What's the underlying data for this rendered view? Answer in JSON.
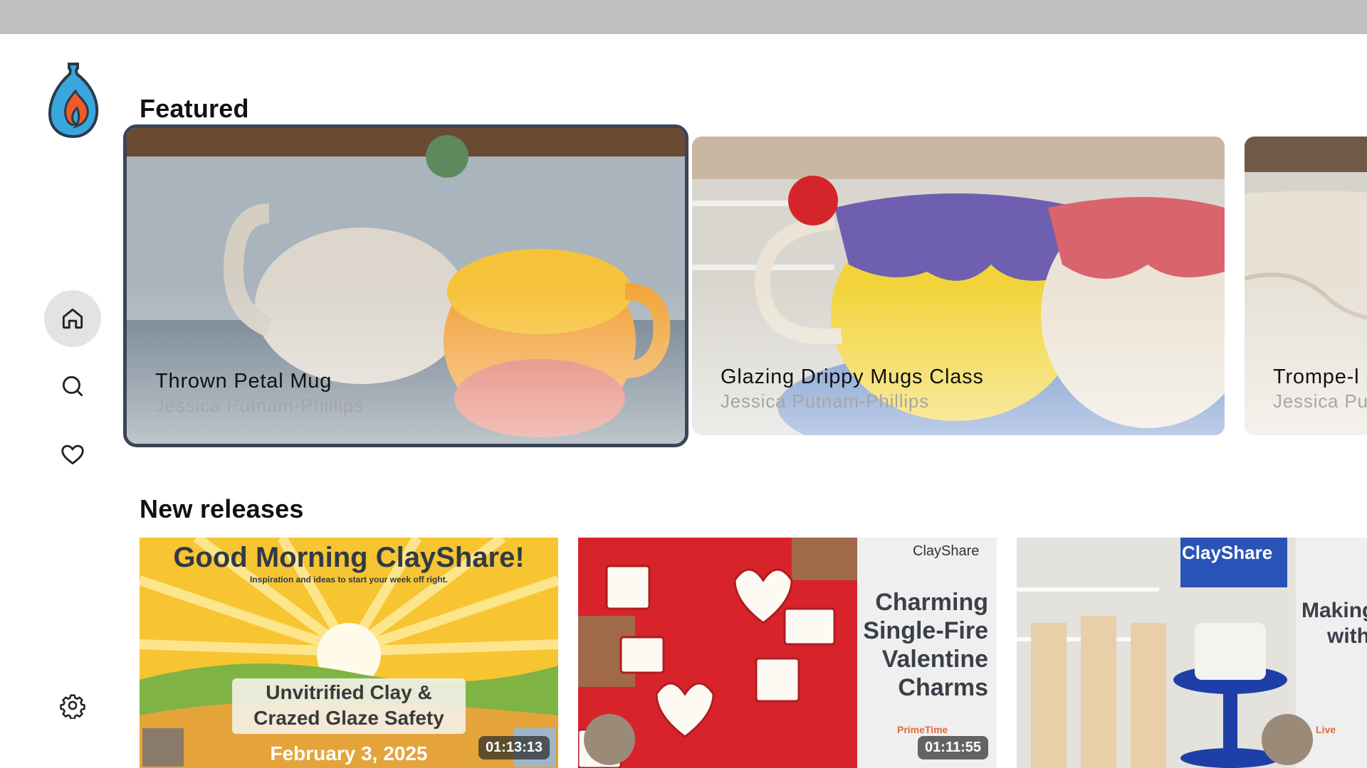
{
  "sections": {
    "featured_title": "Featured",
    "new_releases_title": "New releases"
  },
  "sidebar": {
    "items": [
      {
        "name": "home",
        "icon": "home-icon",
        "active": true
      },
      {
        "name": "search",
        "icon": "search-icon",
        "active": false
      },
      {
        "name": "favorites",
        "icon": "heart-icon",
        "active": false
      },
      {
        "name": "settings",
        "icon": "gear-icon",
        "active": false
      }
    ]
  },
  "featured": [
    {
      "title": "Thrown Petal Mug",
      "author": "Jessica Putnam-Phillips"
    },
    {
      "title": "Glazing Drippy Mugs Class",
      "author": "Jessica Putnam-Phillips"
    },
    {
      "title": "Trompe-l",
      "author": "Jessica Pu"
    }
  ],
  "new_releases": [
    {
      "headline": "Good Morning ClayShare!",
      "tagline": "Inspiration and ideas to start your week off right.",
      "topic_line1": "Unvitrified Clay &",
      "topic_line2": "Crazed Glaze Safety",
      "date": "February 3, 2025",
      "duration": "01:13:13"
    },
    {
      "brand": "ClayShare",
      "title_line1": "Charming",
      "title_line2": "Single-Fire",
      "title_line3": "Valentine",
      "title_line4": "Charms",
      "series": "PrimeTime",
      "duration": "01:11:55"
    },
    {
      "brand": "ClayShare",
      "title_line1": "Making",
      "title_line2": "with",
      "series": "Live"
    }
  ],
  "colors": {
    "focus_ring": "#3a4555",
    "active_nav_bg": "#e3e3e3",
    "valentine_red": "#d8232a"
  }
}
